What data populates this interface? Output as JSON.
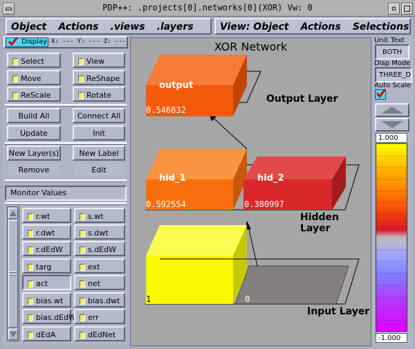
{
  "window": {
    "title": "PDP++: .projects[0].networks[0](XOR) Vw: 0"
  },
  "menus": {
    "left": [
      "Object",
      "Actions",
      ".views",
      ".layers"
    ],
    "right": [
      "View: Object",
      "Actions",
      "Selections"
    ]
  },
  "display_bar": {
    "display_label": "Display",
    "coords": "X: --- Y: --- Z: ---"
  },
  "tools": [
    {
      "label": "Select"
    },
    {
      "label": "View"
    },
    {
      "label": "Move"
    },
    {
      "label": "ReShape"
    },
    {
      "label": "ReScale"
    },
    {
      "label": "Rotate"
    }
  ],
  "actions": {
    "build_all": "Build All",
    "connect_all": "Connect All",
    "update": "Update",
    "init": "Init",
    "new_layer": "New Layer(s)",
    "new_label": "New Label",
    "remove": "Remove",
    "edit": "Edit"
  },
  "monitor_label": "Monitor Values",
  "variables": [
    "r.wt",
    "s.wt",
    "r.dwt",
    "s.dwt",
    "r.dEdW",
    "s.dEdW",
    "targ",
    "ext",
    "act",
    "net",
    "bias.wt",
    "bias.dwt",
    "bias.dEdW",
    "err",
    "dEdA",
    "dEdNet"
  ],
  "network": {
    "title": "XOR Network",
    "layers": {
      "output": {
        "label": "Output Layer",
        "units": [
          {
            "name": "output",
            "value": "0.546832",
            "color": "#f45a0c"
          }
        ]
      },
      "hidden": {
        "label": "Hidden Layer",
        "units": [
          {
            "name": "hid_1",
            "value": "0.592554",
            "color": "#f7700c"
          },
          {
            "name": "hid_2",
            "value": "0.380997",
            "color": "#d8282a"
          }
        ]
      },
      "input": {
        "label": "Input Layer",
        "units": [
          {
            "name": "",
            "value": "1",
            "color": "#f8f800"
          },
          {
            "name": "",
            "value": "0",
            "color": "#858080"
          }
        ]
      }
    }
  },
  "right_panel": {
    "unit_text_label": "Unit Text",
    "unit_text_value": "BOTH",
    "disp_mode_label": "Disp Mode",
    "disp_mode_value": "THREE_D",
    "auto_scale_label": "Auto Scale",
    "max_value": "1.000",
    "min_value": "-1.000"
  },
  "colors": {
    "accent": "#4fd6e8",
    "check": "#cc0000"
  }
}
